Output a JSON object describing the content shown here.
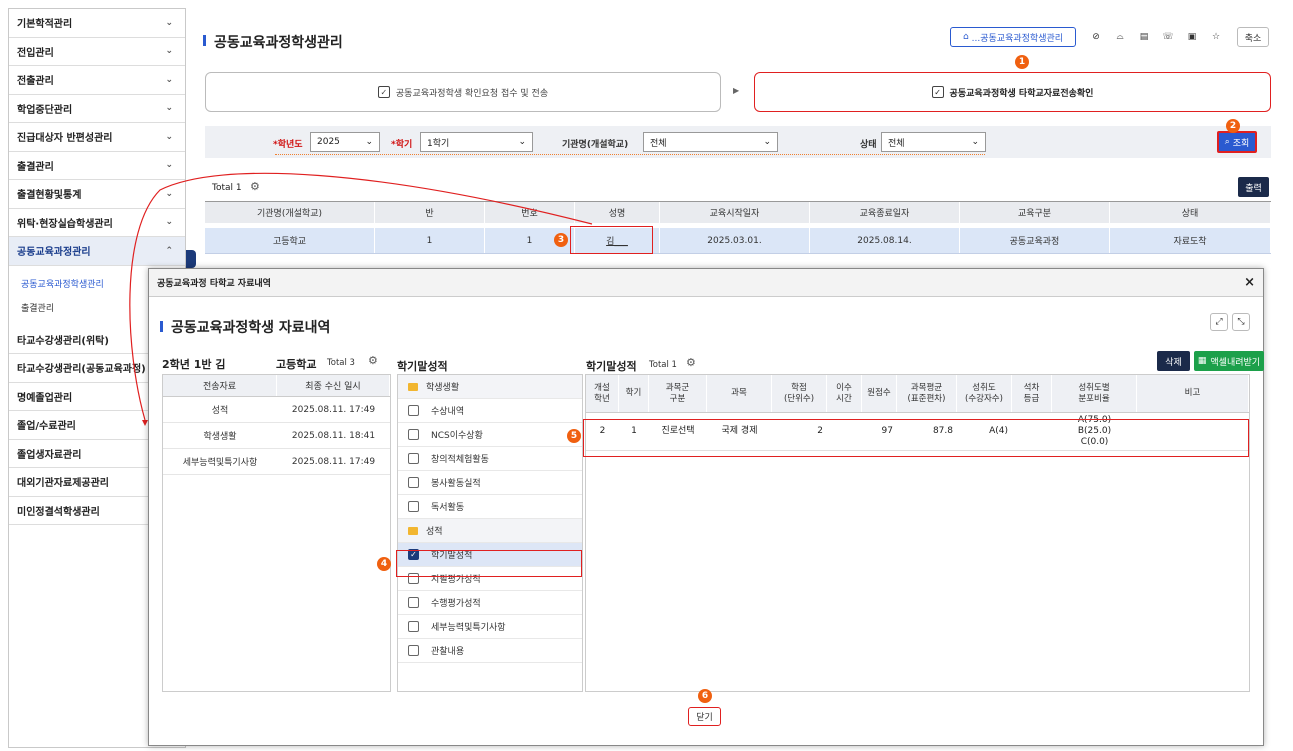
{
  "sidebar": {
    "items": [
      {
        "label": "기본학적관리",
        "chev": "⌄"
      },
      {
        "label": "전입관리",
        "chev": "⌄"
      },
      {
        "label": "전출관리",
        "chev": "⌄"
      },
      {
        "label": "학업중단관리",
        "chev": "⌄"
      },
      {
        "label": "진급대상자 반편성관리",
        "chev": "⌄"
      },
      {
        "label": "출결관리",
        "chev": "⌄"
      },
      {
        "label": "출결현황및통계",
        "chev": "⌄"
      },
      {
        "label": "위탁·현장실습학생관리",
        "chev": "⌄"
      },
      {
        "label": "공동교육과정관리",
        "chev": "⌃"
      }
    ],
    "subitems": [
      "공동교육과정학생관리",
      "출결관리"
    ],
    "items2": [
      "타교수강생관리(위탁)",
      "타교수강생관리(공동교육과정)",
      "명예졸업관리",
      "졸업/수료관리",
      "졸업생자료관리",
      "대외기관자료제공관리",
      "미인정결석학생관리"
    ]
  },
  "header": {
    "title": "공동교육과정학생관리",
    "breadcrumb": "...공동교육과정학생관리",
    "shrink": "축소"
  },
  "steps": {
    "step1": "공동교육과정학생 확인요청 접수 및 전송",
    "step2": "공동교육과정학생 타학교자료전송확인"
  },
  "filter": {
    "year_label": "*학년도",
    "year": "2025",
    "term_label": "*학기",
    "term": "1학기",
    "org_label": "기관명(개설학교)",
    "org": "전체",
    "status_label": "상태",
    "status": "전체",
    "search": "조회"
  },
  "main": {
    "total": "Total 1",
    "print": "출력",
    "columns": [
      "기관명(개설학교)",
      "반",
      "번호",
      "성명",
      "교육시작일자",
      "교육종료일자",
      "교육구분",
      "상태"
    ],
    "row": [
      "고등학교",
      "1",
      "1",
      "김___",
      "2025.03.01.",
      "2025.08.14.",
      "공동교육과정",
      "자료도착"
    ]
  },
  "modal": {
    "header": "공동교육과정 타학교 자료내역",
    "title": "공동교육과정학생 자료내역",
    "close": "×",
    "close_btn": "닫기",
    "left": {
      "student": "2학년 1반 김",
      "school": "고등학교",
      "total": "Total 3",
      "cols": [
        "전송자료",
        "최종 수신 일시"
      ],
      "rows": [
        [
          "성적",
          "2025.08.11. 17:49"
        ],
        [
          "학생생활",
          "2025.08.11. 18:41"
        ],
        [
          "세부능력및특기사항",
          "2025.08.11. 17:49"
        ]
      ]
    },
    "mid": {
      "title": "학기말성적",
      "groups": [
        {
          "label": "학생생활",
          "items": [
            "수상내역",
            "NCS이수상황",
            "창의적체험활동",
            "봉사활동실적",
            "독서활동"
          ]
        },
        {
          "label": "성적",
          "items": [
            "학기말성적",
            "지필평가성적",
            "수행평가성적",
            "세부능력및특기사항",
            "관찰내용"
          ]
        }
      ],
      "checked": "학기말성적"
    },
    "grid": {
      "title": "학기말성적",
      "total": "Total 1",
      "delete": "삭제",
      "excel": "액셀내려받기",
      "cols": [
        "개설\n학년",
        "학기",
        "과목군\n구분",
        "과목",
        "학점\n(단위수)",
        "이수\n시간",
        "원점수",
        "과목평균\n(표준편차)",
        "성취도\n(수강자수)",
        "석차\n등급",
        "성취도별\n분포비율",
        "비고"
      ],
      "row": [
        "2",
        "1",
        "진로선택",
        "국제 경제",
        "2",
        "",
        "97",
        "87.8",
        "A(4)",
        "",
        "A(75.0)\nB(25.0)\nC(0.0)",
        ""
      ]
    }
  },
  "badges": [
    "1",
    "2",
    "3",
    "4",
    "5",
    "6"
  ],
  "colors": {
    "accent": "#2a5ad0",
    "callout": "#e02020",
    "badge": "#f06010"
  }
}
